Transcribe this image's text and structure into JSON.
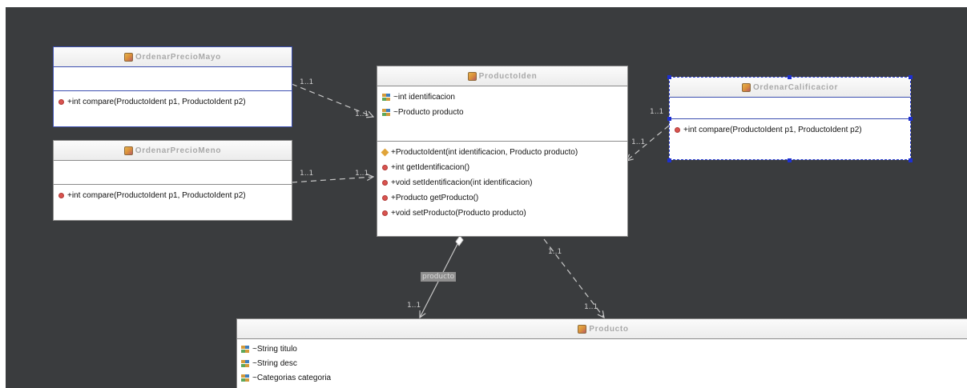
{
  "classes": {
    "ordenar_precio_mayor": {
      "name": "OrdenarPrecioMayo",
      "operations": [
        "+int compare(ProductoIdent p1, ProductoIdent p2)"
      ]
    },
    "ordenar_precio_menor": {
      "name": "OrdenarPrecioMeno",
      "operations": [
        "+int compare(ProductoIdent p1, ProductoIdent p2)"
      ]
    },
    "producto_ident": {
      "name": "ProductoIden",
      "attributes": [
        "~int identificacion",
        "~Producto producto"
      ],
      "constructor": "+ProductoIdent(int identificacion, Producto producto)",
      "operations": [
        "+int getIdentificacion()",
        "+void setIdentificacion(int identificacion)",
        "+Producto getProducto()",
        "+void setProducto(Producto producto)"
      ]
    },
    "ordenar_calificacion": {
      "name": "OrdenarCalificacior",
      "operations": [
        "+int compare(ProductoIdent p1, ProductoIdent p2)"
      ]
    },
    "producto": {
      "name": "Producto",
      "attributes": [
        "~String titulo",
        "~String desc",
        "~Categorias categoria"
      ]
    }
  },
  "multiplicities": {
    "mayor_source": "1..1",
    "mayor_target": "1..1",
    "menor_source": "1..1",
    "menor_target": "1..1",
    "calif_source": "1..1",
    "calif_target": "1..1",
    "ident_dep_source": "1..1",
    "ident_dep_target": "1..1",
    "assoc_target": "1..1"
  },
  "association_role": "producto",
  "colors": {
    "canvas_background": "#3a3c3e",
    "class_fill": "#ffffff",
    "class_name_text": "#a9a9a9",
    "selection_blue": "#1d2fd0",
    "connector": "#c8c8c8",
    "operation_icon": "#d9534f",
    "constructor_icon": "#e0a43a"
  },
  "icons": {
    "class": "class-icon",
    "attribute": "field-icon",
    "operation": "method-icon",
    "constructor": "constructor-icon"
  }
}
